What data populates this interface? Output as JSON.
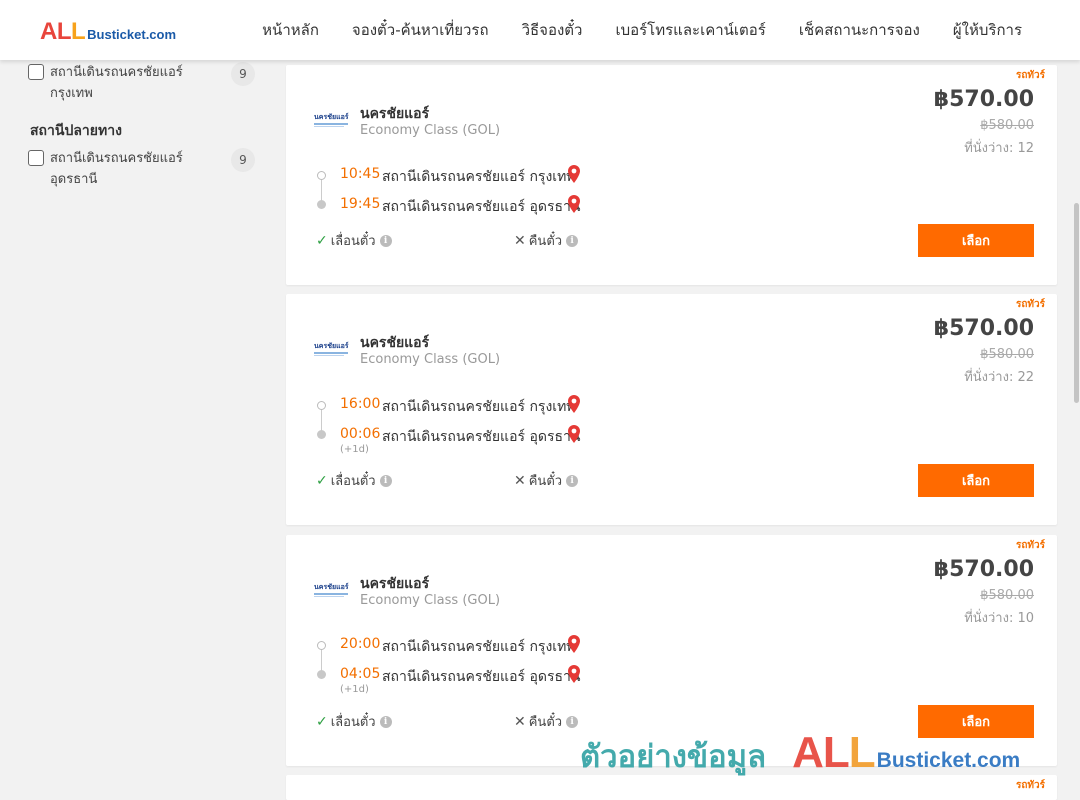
{
  "header": {
    "logo": {
      "all_part1": "AL",
      "all_part2": "L",
      "rest": "Busticket.com"
    },
    "nav": [
      "หน้าหลัก",
      "จองตั๋ว-ค้นหาเที่ยวรถ",
      "วิธีจองตั๋ว",
      "เบอร์โทรและเคาน์เตอร์",
      "เช็คสถานะการจอง",
      "ผู้ให้บริการ"
    ]
  },
  "sidebar": {
    "origin_filter": {
      "label": "สถานีเดินรถนครชัยแอร์ กรุงเทพ",
      "count": "9"
    },
    "destination_heading": "สถานีปลายทาง",
    "destination_filter": {
      "label": "สถานีเดินรถนครชัยแอร์ อุดรธานี",
      "count": "9"
    }
  },
  "trips": [
    {
      "promo": "รถทัวร์",
      "logo_text": "นครชัยแอร์",
      "operator": "นครชัยแอร์",
      "bus_class": "Economy Class (GOL)",
      "price": "฿570.00",
      "old_price": "฿580.00",
      "seats": "ที่นั่งว่าง: 12",
      "depart_time": "10:45",
      "depart_station": "สถานีเดินรถนครชัยแอร์ กรุงเทพ",
      "arrive_time": "19:45",
      "arrive_station": "สถานีเดินรถนครชัยแอร์ อุดรธานี",
      "arrive_nextday": "",
      "feature_change": "เลื่อนตั๋ว",
      "feature_refund": "คืนตั๋ว",
      "select_label": "เลือก"
    },
    {
      "promo": "รถทัวร์",
      "logo_text": "นครชัยแอร์",
      "operator": "นครชัยแอร์",
      "bus_class": "Economy Class (GOL)",
      "price": "฿570.00",
      "old_price": "฿580.00",
      "seats": "ที่นั่งว่าง: 22",
      "depart_time": "16:00",
      "depart_station": "สถานีเดินรถนครชัยแอร์ กรุงเทพ",
      "arrive_time": "00:06",
      "arrive_station": "สถานีเดินรถนครชัยแอร์ อุดรธานี",
      "arrive_nextday": "(+1d)",
      "feature_change": "เลื่อนตั๋ว",
      "feature_refund": "คืนตั๋ว",
      "select_label": "เลือก"
    },
    {
      "promo": "รถทัวร์",
      "logo_text": "นครชัยแอร์",
      "operator": "นครชัยแอร์",
      "bus_class": "Economy Class (GOL)",
      "price": "฿570.00",
      "old_price": "฿580.00",
      "seats": "ที่นั่งว่าง: 10",
      "depart_time": "20:00",
      "depart_station": "สถานีเดินรถนครชัยแอร์ กรุงเทพ",
      "arrive_time": "04:05",
      "arrive_station": "สถานีเดินรถนครชัยแอร์ อุดรธานี",
      "arrive_nextday": "(+1d)",
      "feature_change": "เลื่อนตั๋ว",
      "feature_refund": "คืนตั๋ว",
      "select_label": "เลือก"
    },
    {
      "promo": "รถทัวร์"
    }
  ],
  "icons": {
    "check": "✓",
    "cross": "✕",
    "info": "i",
    "pin_color": "#e53935"
  },
  "colors": {
    "accent": "#ff6a00",
    "time": "#f36f00",
    "check": "#2ea043"
  },
  "watermark": {
    "thai": "ตัวอย่างข้อมูล",
    "all_part1": "AL",
    "all_part2": "L",
    "rest": "Busticket.com"
  }
}
